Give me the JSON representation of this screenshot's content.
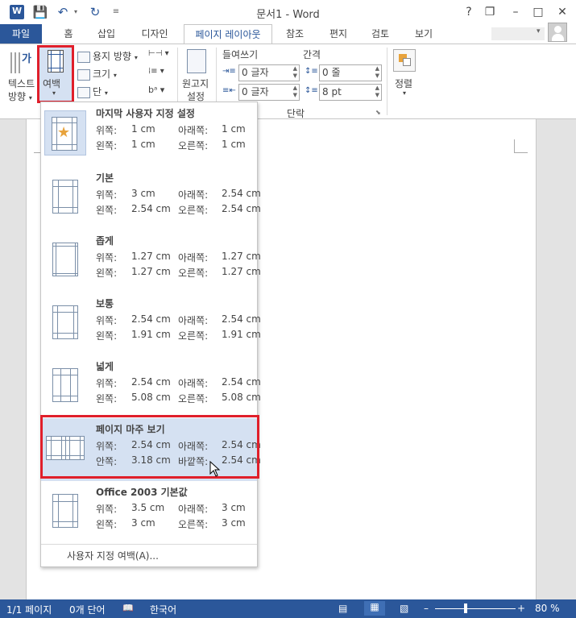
{
  "titlebar": {
    "title": "문서1 - Word",
    "help": "?",
    "restore": "❐",
    "minimize": "–",
    "maximize": "□",
    "close": "✕",
    "qat_save": "💾",
    "qat_undo": "↶",
    "qat_redo": "↻",
    "qat_more": "≡"
  },
  "tabs": [
    {
      "label": "파일"
    },
    {
      "label": "홈"
    },
    {
      "label": "삽입"
    },
    {
      "label": "디자인"
    },
    {
      "label": "페이지 레이아웃"
    },
    {
      "label": "참조"
    },
    {
      "label": "편지"
    },
    {
      "label": "검토"
    },
    {
      "label": "보기"
    }
  ],
  "ribbon": {
    "text_direction": "텍스트",
    "text_direction2": "방향",
    "margins": "여백",
    "orientation": "용지 방향",
    "size": "크기",
    "columns": "단",
    "manuscript": "원고지",
    "manuscript2": "설정",
    "indent_title": "들여쓰기",
    "spacing_title": "간격",
    "indent_left": "0 글자",
    "indent_right": "0 글자",
    "spacing_before": "0 줄",
    "spacing_after": "8 pt",
    "paragraph_group": "단락",
    "arrange": "정렬",
    "hyphen_icon": "bᵃ"
  },
  "margins_menu": {
    "options": [
      {
        "name": "마지막 사용자 지정 설정",
        "l1": "위쪽:",
        "v1": "1 cm",
        "l2": "아래쪽:",
        "v2": "1 cm",
        "l3": "왼쪽:",
        "v3": "1 cm",
        "l4": "오른쪽:",
        "v4": "1 cm"
      },
      {
        "name": "기본",
        "l1": "위쪽:",
        "v1": "3 cm",
        "l2": "아래쪽:",
        "v2": "2.54 cm",
        "l3": "왼쪽:",
        "v3": "2.54 cm",
        "l4": "오른쪽:",
        "v4": "2.54 cm"
      },
      {
        "name": "좁게",
        "l1": "위쪽:",
        "v1": "1.27 cm",
        "l2": "아래쪽:",
        "v2": "1.27 cm",
        "l3": "왼쪽:",
        "v3": "1.27 cm",
        "l4": "오른쪽:",
        "v4": "1.27 cm"
      },
      {
        "name": "보통",
        "l1": "위쪽:",
        "v1": "2.54 cm",
        "l2": "아래쪽:",
        "v2": "2.54 cm",
        "l3": "왼쪽:",
        "v3": "1.91 cm",
        "l4": "오른쪽:",
        "v4": "1.91 cm"
      },
      {
        "name": "넓게",
        "l1": "위쪽:",
        "v1": "2.54 cm",
        "l2": "아래쪽:",
        "v2": "2.54 cm",
        "l3": "왼쪽:",
        "v3": "5.08 cm",
        "l4": "오른쪽:",
        "v4": "5.08 cm"
      },
      {
        "name": "페이지 마주 보기",
        "l1": "위쪽:",
        "v1": "2.54 cm",
        "l2": "아래쪽:",
        "v2": "2.54 cm",
        "l3": "안쪽:",
        "v3": "3.18 cm",
        "l4": "바깥쪽:",
        "v4": "2.54 cm"
      },
      {
        "name": "Office 2003 기본값",
        "l1": "위쪽:",
        "v1": "3.5 cm",
        "l2": "아래쪽:",
        "v2": "3 cm",
        "l3": "왼쪽:",
        "v3": "3 cm",
        "l4": "오른쪽:",
        "v4": "3 cm"
      }
    ],
    "custom": "사용자 지정 여백(A)..."
  },
  "statusbar": {
    "page": "1/1 페이지",
    "words": "0개 단어",
    "language": "한국어",
    "zoom": "80 %",
    "zoom_minus": "–",
    "zoom_plus": "+"
  },
  "colors": {
    "accent": "#2b579a",
    "highlight": "#e01f2b",
    "selection": "#d5e1f2"
  }
}
